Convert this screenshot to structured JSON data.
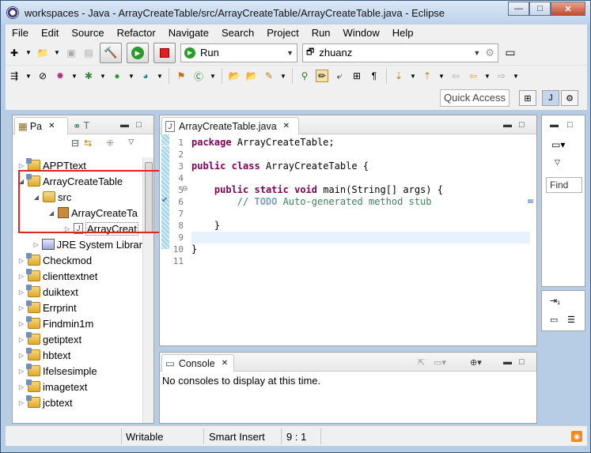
{
  "window": {
    "title": "workspaces - Java - ArrayCreateTable/src/ArrayCreateTable/ArrayCreateTable.java - Eclipse",
    "minimize": "—",
    "maximize": "□",
    "close": "✕"
  },
  "menu": [
    "File",
    "Edit",
    "Source",
    "Refactor",
    "Navigate",
    "Search",
    "Project",
    "Run",
    "Window",
    "Help"
  ],
  "toolbar": {
    "run_config": "Run",
    "workspace_combo": "zhuanz",
    "quick_access": "Quick Access"
  },
  "package_explorer": {
    "tab_label": "Pa",
    "tab2_label": "T",
    "items": [
      {
        "label": "APPTtext",
        "arrow": "▷"
      },
      {
        "label": "ArrayCreateTable",
        "arrow": "◢"
      },
      {
        "label": "src",
        "arrow": "◢"
      },
      {
        "label": "ArrayCreateTa",
        "arrow": "◢"
      },
      {
        "label": "ArrayCreat",
        "arrow": "▷"
      },
      {
        "label": "JRE System Librar",
        "arrow": "▷"
      },
      {
        "label": "Checkmod",
        "arrow": "▷"
      },
      {
        "label": "clienttextnet",
        "arrow": "▷"
      },
      {
        "label": "duiktext",
        "arrow": "▷"
      },
      {
        "label": "Errprint",
        "arrow": "▷"
      },
      {
        "label": "Findmin1m",
        "arrow": "▷"
      },
      {
        "label": "getiptext",
        "arrow": "▷"
      },
      {
        "label": "hbtext",
        "arrow": "▷"
      },
      {
        "label": "Ifelsesimple",
        "arrow": "▷"
      },
      {
        "label": "imagetext",
        "arrow": "▷"
      },
      {
        "label": "jcbtext",
        "arrow": "▷"
      }
    ]
  },
  "editor": {
    "tab_label": "ArrayCreateTable.java",
    "line_numbers": [
      "1",
      "2",
      "3",
      "4",
      "5",
      "6",
      "7",
      "8",
      "9",
      "10",
      "11"
    ],
    "lines": {
      "l1_kw": "package",
      "l1_rest": " ArrayCreateTable;",
      "l3_kw1": "public",
      "l3_kw2": "class",
      "l3_rest": " ArrayCreateTable {",
      "l5_kw1": "public",
      "l5_kw2": "static",
      "l5_kw3": "void",
      "l5_rest": " main(String[] args) {",
      "l6_prefix": "// ",
      "l6_todo": "TODO",
      "l6_rest": " Auto-generated method stub",
      "l8": "}",
      "l10": "}"
    }
  },
  "outline": {
    "find_label": "Find"
  },
  "console": {
    "tab_label": "Console",
    "message": "No consoles to display at this time."
  },
  "status": {
    "mode": "Writable",
    "insert": "Smart Insert",
    "position": "9 : 1"
  },
  "colors": {
    "keyword": "#7f0055",
    "comment": "#3f7f5f",
    "highlight_box": "#e02323"
  }
}
